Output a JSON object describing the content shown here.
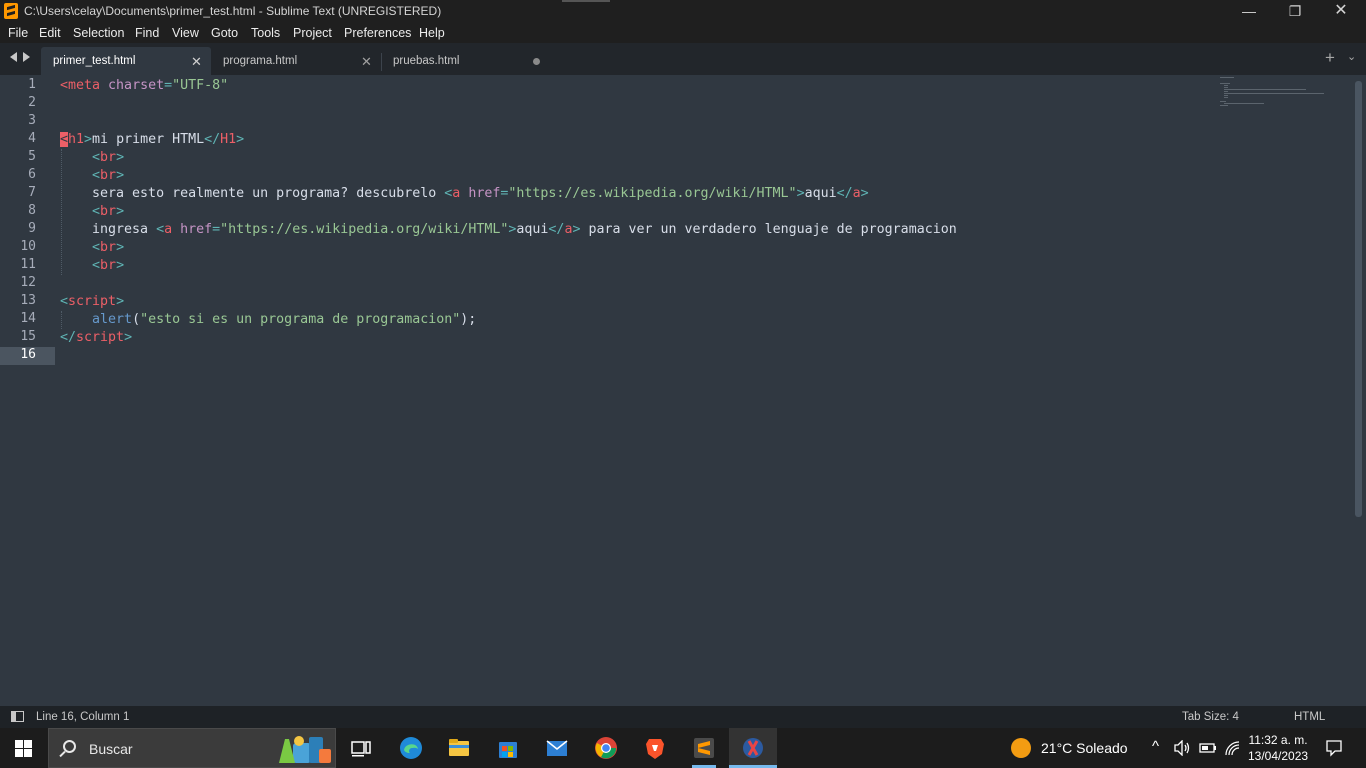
{
  "window": {
    "title": "C:\\Users\\celay\\Documents\\primer_test.html - Sublime Text (UNREGISTERED)",
    "controls": {
      "minimize": "—",
      "maximize": "❐",
      "close": "✕"
    }
  },
  "menu": [
    "File",
    "Edit",
    "Selection",
    "Find",
    "View",
    "Goto",
    "Tools",
    "Project",
    "Preferences",
    "Help"
  ],
  "tabs": [
    {
      "label": "primer_test.html",
      "active": true,
      "close": "✕"
    },
    {
      "label": "programa.html",
      "active": false,
      "close": "✕"
    },
    {
      "label": "pruebas.html",
      "active": false,
      "modified": true
    }
  ],
  "tabbar": {
    "add": "+",
    "more": "⌄"
  },
  "editor": {
    "current_line": "16",
    "line_numbers": [
      "1",
      "2",
      "3",
      "4",
      "5",
      "6",
      "7",
      "8",
      "9",
      "10",
      "11",
      "12",
      "13",
      "14",
      "15",
      "16"
    ],
    "lines": [
      [
        {
          "t": "tag",
          "v": "<meta"
        },
        {
          "t": "text",
          "v": " "
        },
        {
          "t": "attr",
          "v": "charset"
        },
        {
          "t": "punct",
          "v": "="
        },
        {
          "t": "str",
          "v": "\"UTF-8\""
        }
      ],
      [],
      [],
      [
        {
          "t": "err",
          "v": "<"
        },
        {
          "t": "tag",
          "v": "h1"
        },
        {
          "t": "punct",
          "v": ">"
        },
        {
          "t": "text",
          "v": "mi primer HTML"
        },
        {
          "t": "punct",
          "v": "</"
        },
        {
          "t": "tag",
          "v": "H1"
        },
        {
          "t": "punct",
          "v": ">"
        }
      ],
      [
        {
          "t": "text",
          "v": "    "
        },
        {
          "t": "punct",
          "v": "<"
        },
        {
          "t": "tag",
          "v": "br"
        },
        {
          "t": "punct",
          "v": ">"
        }
      ],
      [
        {
          "t": "text",
          "v": "    "
        },
        {
          "t": "punct",
          "v": "<"
        },
        {
          "t": "tag",
          "v": "br"
        },
        {
          "t": "punct",
          "v": ">"
        }
      ],
      [
        {
          "t": "text",
          "v": "    sera esto realmente un programa? descubrelo "
        },
        {
          "t": "punct",
          "v": "<"
        },
        {
          "t": "tag",
          "v": "a"
        },
        {
          "t": "text",
          "v": " "
        },
        {
          "t": "attr",
          "v": "href"
        },
        {
          "t": "punct",
          "v": "="
        },
        {
          "t": "str",
          "v": "\"https://es.wikipedia.org/wiki/HTML\""
        },
        {
          "t": "punct",
          "v": ">"
        },
        {
          "t": "text",
          "v": "aqui"
        },
        {
          "t": "punct",
          "v": "</"
        },
        {
          "t": "tag",
          "v": "a"
        },
        {
          "t": "punct",
          "v": ">"
        }
      ],
      [
        {
          "t": "text",
          "v": "    "
        },
        {
          "t": "punct",
          "v": "<"
        },
        {
          "t": "tag",
          "v": "br"
        },
        {
          "t": "punct",
          "v": ">"
        }
      ],
      [
        {
          "t": "text",
          "v": "    ingresa "
        },
        {
          "t": "punct",
          "v": "<"
        },
        {
          "t": "tag",
          "v": "a"
        },
        {
          "t": "text",
          "v": " "
        },
        {
          "t": "attr",
          "v": "href"
        },
        {
          "t": "punct",
          "v": "="
        },
        {
          "t": "str",
          "v": "\"https://es.wikipedia.org/wiki/HTML\""
        },
        {
          "t": "punct",
          "v": ">"
        },
        {
          "t": "text",
          "v": "aqui"
        },
        {
          "t": "punct",
          "v": "</"
        },
        {
          "t": "tag",
          "v": "a"
        },
        {
          "t": "punct",
          "v": ">"
        },
        {
          "t": "text",
          "v": " para ver un verdadero lenguaje de programacion"
        }
      ],
      [
        {
          "t": "text",
          "v": "    "
        },
        {
          "t": "punct",
          "v": "<"
        },
        {
          "t": "tag",
          "v": "br"
        },
        {
          "t": "punct",
          "v": ">"
        }
      ],
      [
        {
          "t": "text",
          "v": "    "
        },
        {
          "t": "punct",
          "v": "<"
        },
        {
          "t": "tag",
          "v": "br"
        },
        {
          "t": "punct",
          "v": ">"
        }
      ],
      [],
      [
        {
          "t": "punct",
          "v": "<"
        },
        {
          "t": "tag",
          "v": "script"
        },
        {
          "t": "punct",
          "v": ">"
        }
      ],
      [
        {
          "t": "text",
          "v": "    "
        },
        {
          "t": "func",
          "v": "alert"
        },
        {
          "t": "text",
          "v": "("
        },
        {
          "t": "str",
          "v": "\"esto si es un programa de programacion\""
        },
        {
          "t": "text",
          "v": ");"
        }
      ],
      [
        {
          "t": "punct",
          "v": "</"
        },
        {
          "t": "tag",
          "v": "script"
        },
        {
          "t": "punct",
          "v": ">"
        }
      ],
      []
    ]
  },
  "statusbar": {
    "position": "Line 16, Column 1",
    "tab_size": "Tab Size: 4",
    "syntax": "HTML"
  },
  "taskbar": {
    "search_placeholder": "Buscar",
    "weather": "21°C  Soleado",
    "time": "11:32 a. m.",
    "date": "13/04/2023",
    "icons": [
      "task-view-icon",
      "edge-icon",
      "file-explorer-icon",
      "store-icon",
      "mail-icon",
      "chrome-icon",
      "brave-icon",
      "sublime-icon",
      "app-icon"
    ]
  },
  "colors": {
    "editor_bg": "#303841",
    "tag": "#ec5f67",
    "punct": "#5fb4b4",
    "attr": "#c594c5",
    "string": "#99c794",
    "function": "#6699cc",
    "text": "#d8dee9"
  }
}
